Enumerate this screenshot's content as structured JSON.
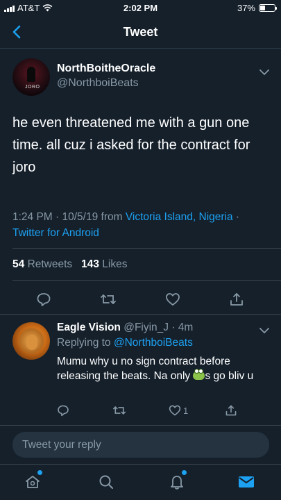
{
  "status_bar": {
    "carrier": "AT&T",
    "time": "2:02 PM",
    "battery": "37%",
    "battery_level": 0.37
  },
  "nav": {
    "title": "Tweet"
  },
  "tweet": {
    "display_name": "NorthBoitheOracle",
    "handle": "@NorthboiBeats",
    "avatar_label": "JORO",
    "text": "he even threatened me with a gun one time. all cuz i asked for the contract for joro",
    "meta_time": "1:24 PM · 10/5/19 from ",
    "meta_location": "Victoria Island, Nigeria",
    "meta_sep": " · ",
    "meta_client": "Twitter for Android",
    "retweets_count": "54",
    "retweets_label": "Retweets",
    "likes_count": "143",
    "likes_label": "Likes"
  },
  "reply": {
    "display_name": "Eagle Vision",
    "handle_time": "@Fiyin_J · 4m",
    "replying_prefix": "Replying to ",
    "replying_to": "@NorthboiBeats",
    "text_before": "Mumu why u no sign contract before releasing the beats. Na only ",
    "text_after": "s go bliv u",
    "like_count": "1"
  },
  "compose": {
    "placeholder": "Tweet your reply"
  },
  "colors": {
    "background": "#15202b",
    "accent": "#1da1f2",
    "muted": "#8899a6",
    "divider": "#38444d"
  },
  "icons": [
    "back-chevron-icon",
    "caret-down-icon",
    "reply-icon",
    "retweet-icon",
    "like-icon",
    "share-icon",
    "home-icon",
    "search-icon",
    "notifications-icon",
    "messages-icon"
  ]
}
